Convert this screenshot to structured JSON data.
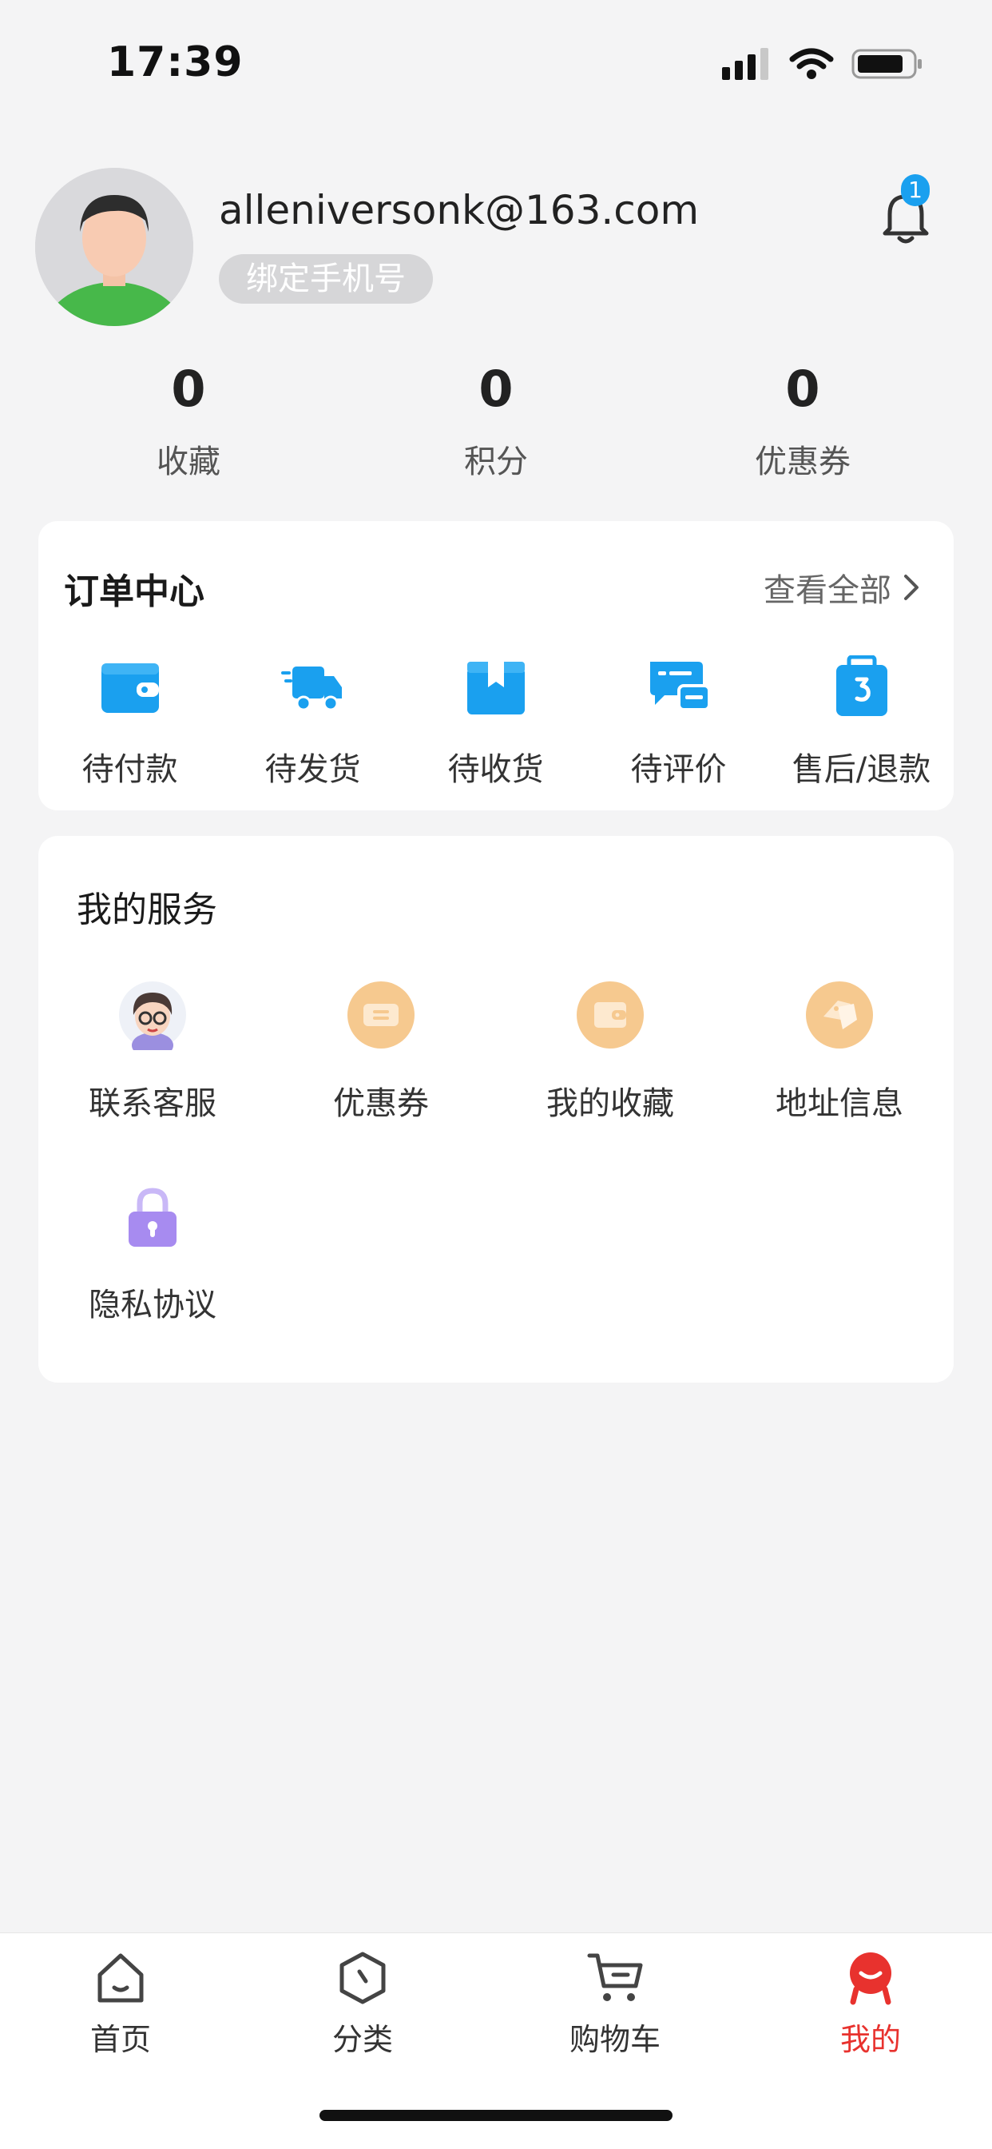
{
  "status_bar": {
    "time": "17:39"
  },
  "profile": {
    "email": "alleniversonk@163.com",
    "bind_phone_label": "绑定手机号",
    "notification_count": "1"
  },
  "stats": [
    {
      "value": "0",
      "label": "收藏"
    },
    {
      "value": "0",
      "label": "积分"
    },
    {
      "value": "0",
      "label": "优惠券"
    }
  ],
  "orders": {
    "title": "订单中心",
    "view_all": "查看全部",
    "items": [
      {
        "label": "待付款",
        "icon": "wallet-icon"
      },
      {
        "label": "待发货",
        "icon": "delivery-truck-icon"
      },
      {
        "label": "待收货",
        "icon": "package-box-icon"
      },
      {
        "label": "待评价",
        "icon": "review-chat-icon"
      },
      {
        "label": "售后/退款",
        "icon": "refund-bag-icon"
      }
    ]
  },
  "services": {
    "title": "我的服务",
    "items": [
      {
        "label": "联系客服",
        "icon": "customer-service-avatar-icon"
      },
      {
        "label": "优惠券",
        "icon": "coupon-icon"
      },
      {
        "label": "我的收藏",
        "icon": "favorites-wallet-icon"
      },
      {
        "label": "地址信息",
        "icon": "address-tag-icon"
      },
      {
        "label": "隐私协议",
        "icon": "lock-icon"
      }
    ]
  },
  "tabbar": {
    "items": [
      {
        "label": "首页",
        "icon": "home-icon"
      },
      {
        "label": "分类",
        "icon": "category-icon"
      },
      {
        "label": "购物车",
        "icon": "cart-icon"
      },
      {
        "label": "我的",
        "icon": "profile-icon",
        "active": true
      }
    ]
  },
  "colors": {
    "accent_blue": "#1aa0ef",
    "active_red": "#e8322e",
    "service_orange": "#f6c98f",
    "lock_purple": "#a78bf0",
    "background": "#f4f4f5"
  }
}
